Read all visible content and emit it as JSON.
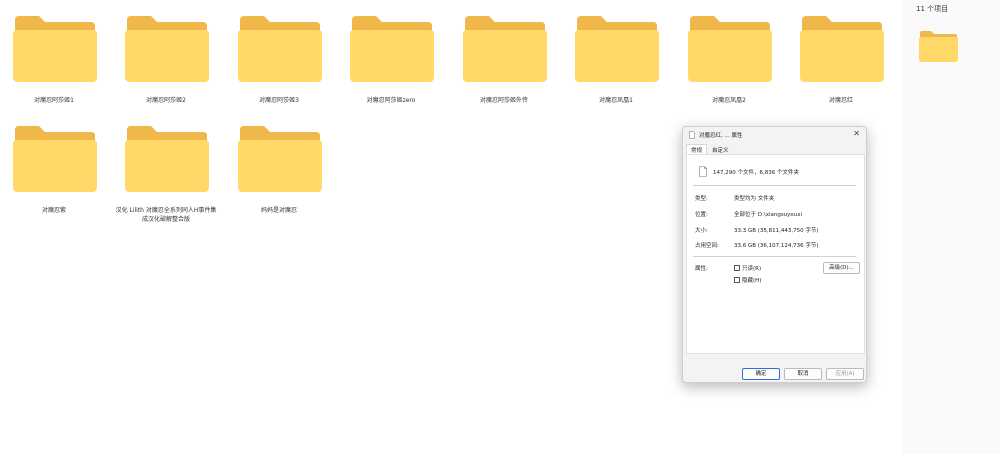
{
  "colors": {
    "folder_back": "#F0B84A",
    "folder_front": "#FFD868",
    "dialog_bg": "#F3F3F3",
    "primary_border": "#2F6FD6"
  },
  "folders": [
    {
      "name": "对魔忍阿莎姬1"
    },
    {
      "name": "对魔忍阿莎姬2"
    },
    {
      "name": "对魔忍阿莎姬3"
    },
    {
      "name": "对魔忍阿莎姬zero"
    },
    {
      "name": "对魔忍阿莎姬外传"
    },
    {
      "name": "对魔忍凤凰1"
    },
    {
      "name": "对魔忍凤凰2"
    },
    {
      "name": "对魔忍红"
    },
    {
      "name": "对魔忍紫"
    },
    {
      "name": "汉化 Lilith 对魔忍全系列同人H事件集成汉化破解整合版"
    },
    {
      "name": "妈妈是对魔忍"
    }
  ],
  "right_pane": {
    "item_count": "11 个项目",
    "preview_icon": "folder-icon"
  },
  "dialog": {
    "title": "对魔忍红, ... 属性",
    "close_glyph": "✕",
    "tabs": [
      {
        "label": "常规"
      },
      {
        "label": "自定义"
      }
    ],
    "summary": "147,290 个文件，6,836 个文件夹",
    "rows": {
      "type": {
        "label": "类型:",
        "value": "类型均为 文件夹"
      },
      "location": {
        "label": "位置:",
        "value": "全部位于 D:\\xiangsuyouxi"
      },
      "size": {
        "label": "大小:",
        "value": "33.3 GB (35,811,443,750 字节)"
      },
      "size_on_disk": {
        "label": "占用空间:",
        "value": "33.6 GB (36,107,124,736 字节)"
      },
      "attributes": {
        "label": "属性:"
      }
    },
    "checkboxes": {
      "readonly": "只读(R)",
      "hidden": "隐藏(H)"
    },
    "advanced_button": "高级(D)...",
    "buttons": {
      "ok": "确定",
      "cancel": "取消",
      "apply": "应用(A)"
    }
  }
}
